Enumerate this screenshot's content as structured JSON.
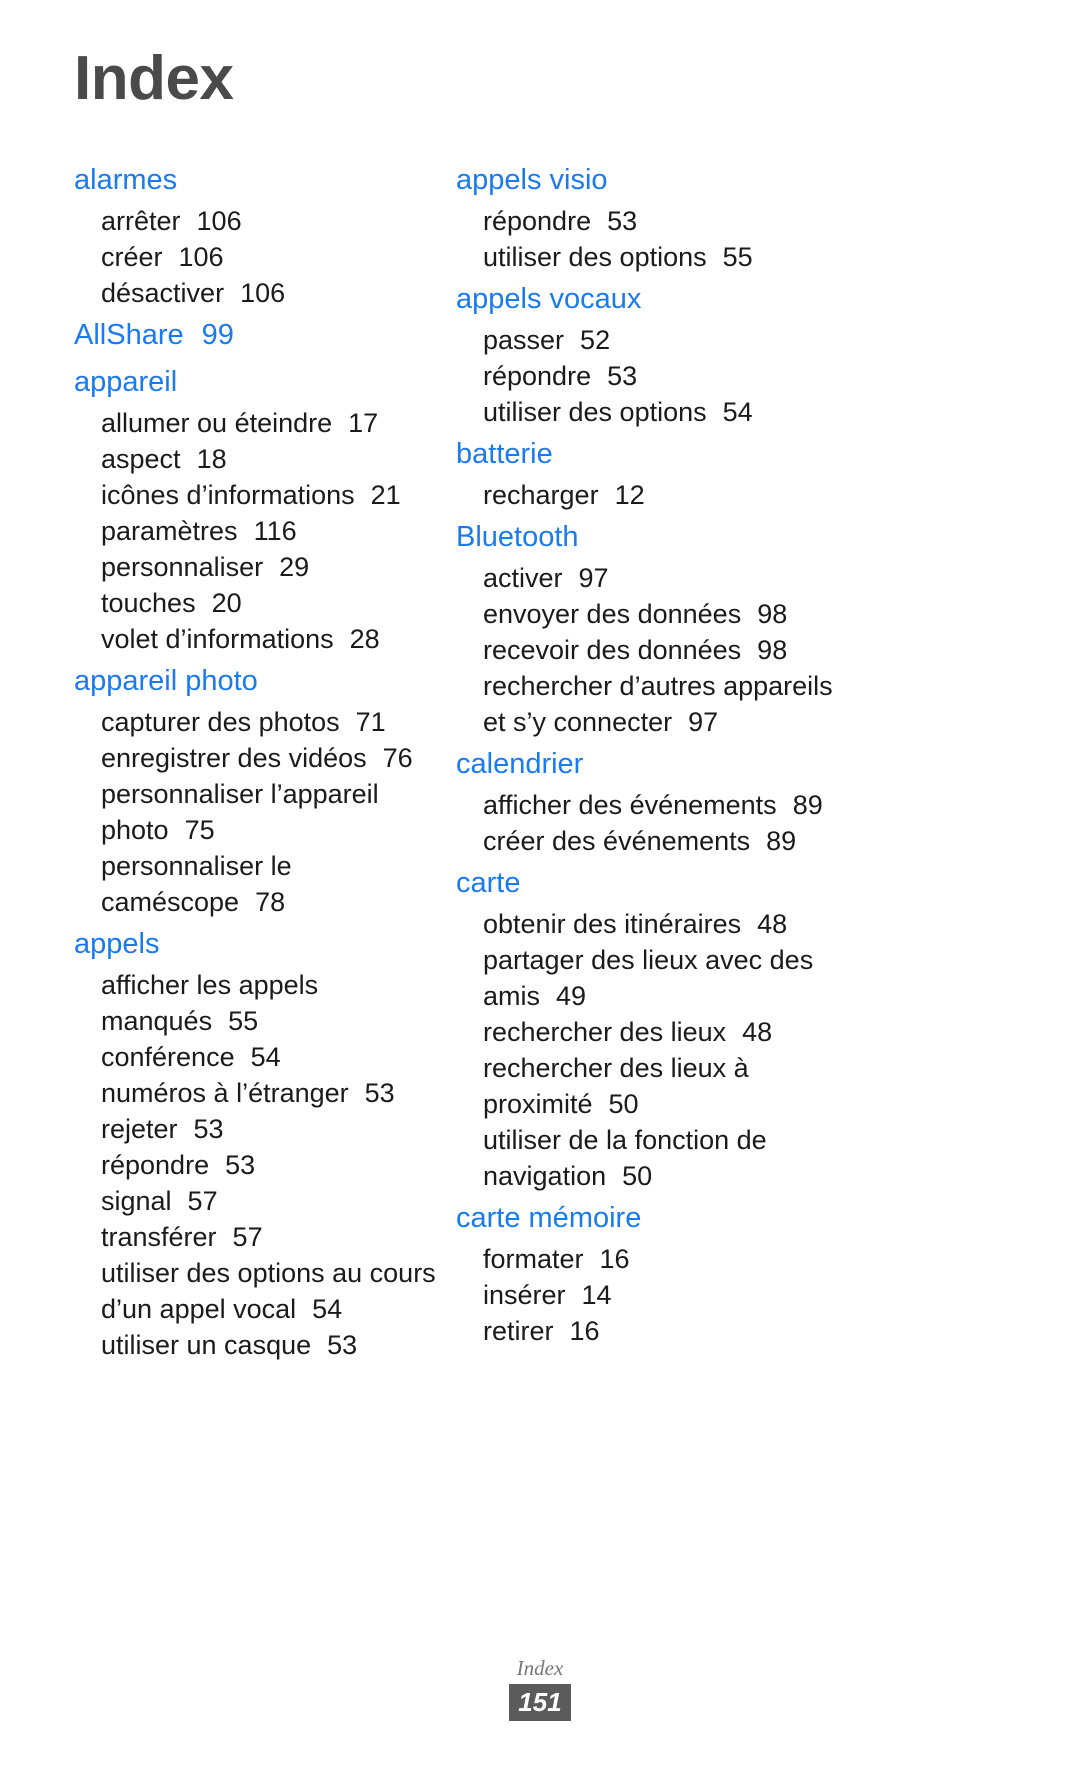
{
  "document": {
    "title": "Index",
    "title_color": "#4a4a4a",
    "heading_color": "#1a7bf0",
    "body_color": "#1b1b1b"
  },
  "columns": [
    {
      "name": "left-column",
      "entries": [
        {
          "term": "alarmes",
          "page": "",
          "subentries": [
            {
              "label": "arrêter",
              "page": "106"
            },
            {
              "label": "créer",
              "page": "106"
            },
            {
              "label": "désactiver",
              "page": "106"
            }
          ]
        },
        {
          "term": "AllShare",
          "page": "99",
          "subentries": []
        },
        {
          "term": "appareil",
          "page": "",
          "subentries": [
            {
              "label": "allumer ou éteindre",
              "page": "17"
            },
            {
              "label": "aspect",
              "page": "18"
            },
            {
              "label": "icônes d’informations",
              "page": "21"
            },
            {
              "label": "paramètres",
              "page": "116"
            },
            {
              "label": "personnaliser",
              "page": "29"
            },
            {
              "label": "touches",
              "page": "20"
            },
            {
              "label": "volet d’informations",
              "page": "28"
            }
          ]
        },
        {
          "term": "appareil photo",
          "page": "",
          "subentries": [
            {
              "label": "capturer des photos",
              "page": "71"
            },
            {
              "label": "enregistrer des vidéos",
              "page": "76"
            },
            {
              "label": "personnaliser l’appareil",
              "page": ""
            },
            {
              "label": "photo",
              "page": "75"
            },
            {
              "label": "personnaliser le",
              "page": ""
            },
            {
              "label": "caméscope",
              "page": "78"
            }
          ]
        },
        {
          "term": "appels",
          "page": "",
          "subentries": [
            {
              "label": "afficher les appels",
              "page": ""
            },
            {
              "label": "manqués",
              "page": "55"
            },
            {
              "label": "conférence",
              "page": "54"
            },
            {
              "label": "numéros à l’étranger",
              "page": "53"
            },
            {
              "label": "rejeter",
              "page": "53"
            },
            {
              "label": "répondre",
              "page": "53"
            },
            {
              "label": "signal",
              "page": "57"
            },
            {
              "label": "transférer",
              "page": "57"
            },
            {
              "label": "utiliser des options au cours",
              "page": ""
            },
            {
              "label": "d’un appel vocal",
              "page": "54"
            },
            {
              "label": "utiliser un casque",
              "page": "53"
            }
          ]
        }
      ]
    },
    {
      "name": "right-column",
      "entries": [
        {
          "term": "appels visio",
          "page": "",
          "subentries": [
            {
              "label": "répondre",
              "page": "53"
            },
            {
              "label": "utiliser des options",
              "page": "55"
            }
          ]
        },
        {
          "term": "appels vocaux",
          "page": "",
          "subentries": [
            {
              "label": "passer",
              "page": "52"
            },
            {
              "label": "répondre",
              "page": "53"
            },
            {
              "label": "utiliser des options",
              "page": "54"
            }
          ]
        },
        {
          "term": "batterie",
          "page": "",
          "subentries": [
            {
              "label": "recharger",
              "page": "12"
            }
          ]
        },
        {
          "term": "Bluetooth",
          "page": "",
          "subentries": [
            {
              "label": "activer",
              "page": "97"
            },
            {
              "label": "envoyer des données",
              "page": "98"
            },
            {
              "label": "recevoir des données",
              "page": "98"
            },
            {
              "label": "rechercher d’autres appareils",
              "page": ""
            },
            {
              "label": "et s’y connecter",
              "page": "97"
            }
          ]
        },
        {
          "term": "calendrier",
          "page": "",
          "subentries": [
            {
              "label": "afficher des événements",
              "page": "89"
            },
            {
              "label": "créer des événements",
              "page": "89"
            }
          ]
        },
        {
          "term": "carte",
          "page": "",
          "subentries": [
            {
              "label": "obtenir des itinéraires",
              "page": "48"
            },
            {
              "label": "partager des lieux avec des",
              "page": ""
            },
            {
              "label": "amis",
              "page": "49"
            },
            {
              "label": "rechercher des lieux",
              "page": "48"
            },
            {
              "label": "rechercher des lieux à",
              "page": ""
            },
            {
              "label": "proximité",
              "page": "50"
            },
            {
              "label": "utiliser de la fonction de",
              "page": ""
            },
            {
              "label": "navigation",
              "page": "50"
            }
          ]
        },
        {
          "term": "carte mémoire",
          "page": "",
          "subentries": [
            {
              "label": "formater",
              "page": "16"
            },
            {
              "label": "insérer",
              "page": "14"
            },
            {
              "label": "retirer",
              "page": "16"
            }
          ]
        }
      ]
    }
  ],
  "footer": {
    "label": "Index",
    "page_number": "151"
  }
}
